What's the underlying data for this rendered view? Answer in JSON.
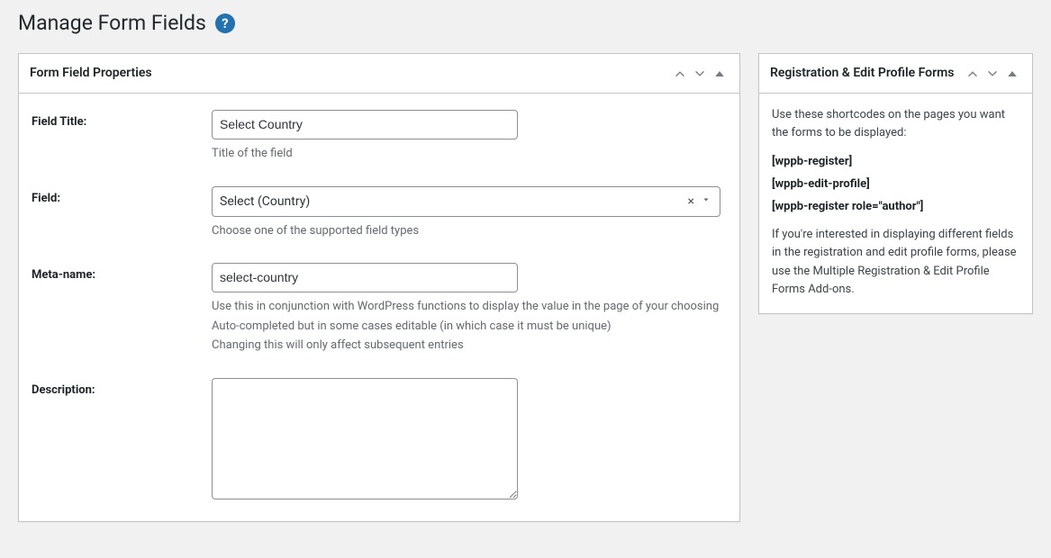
{
  "page": {
    "title": "Manage Form Fields"
  },
  "mainBox": {
    "title": "Form Field Properties",
    "fields": {
      "fieldTitle": {
        "label": "Field Title:",
        "value": "Select Country",
        "helper": "Title of the field"
      },
      "field": {
        "label": "Field:",
        "value": "Select (Country)",
        "helper": "Choose one of the supported field types"
      },
      "metaName": {
        "label": "Meta-name:",
        "value": "select-country",
        "helper1": "Use this in conjunction with WordPress functions to display the value in the page of your choosing",
        "helper2": "Auto-completed but in some cases editable (in which case it must be unique)",
        "helper3": "Changing this will only affect subsequent entries"
      },
      "description": {
        "label": "Description:",
        "value": ""
      }
    }
  },
  "sideBox": {
    "title": "Registration & Edit Profile Forms",
    "intro": "Use these shortcodes on the pages you want the forms to be displayed:",
    "shortcodes": [
      "[wppb-register]",
      "[wppb-edit-profile]",
      "[wppb-register role=\"author\"]"
    ],
    "outro": "If you're interested in displaying different fields in the registration and edit profile forms, please use the Multiple Registration & Edit Profile Forms Add-ons."
  }
}
